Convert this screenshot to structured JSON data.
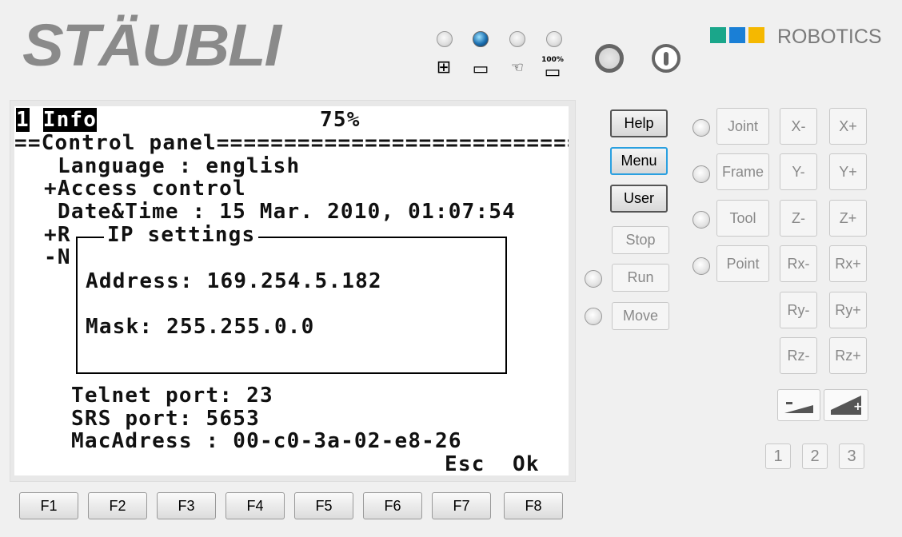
{
  "brand": {
    "logo": "STÄUBLI",
    "robotics": "ROBOTICS",
    "colors": [
      "#1aa68a",
      "#1a7fd6",
      "#f5b800"
    ]
  },
  "mode_indicators": [
    {
      "name": "remote-mode",
      "active": false,
      "glyph": "⊞"
    },
    {
      "name": "local-mode",
      "active": true,
      "glyph": "▭"
    },
    {
      "name": "manual-mode",
      "active": false,
      "glyph": "☜"
    },
    {
      "name": "speed-100",
      "active": false,
      "label": "100%",
      "glyph": "▭"
    }
  ],
  "screen": {
    "tab_number": "1",
    "tab_title": "Info",
    "speed": "75%",
    "section": "==Control panel===========================",
    "lines": {
      "language": "Language : english",
      "access": "+Access control",
      "datetime": "Date&Time : 15 Mar. 2010, 01:07:54",
      "r_prefix": "+R",
      "n_prefix": "-N"
    },
    "ip_dialog": {
      "title": "IP settings",
      "address": "Address: 169.254.5.182",
      "mask": "Mask: 255.255.0.0"
    },
    "lines2": {
      "telnet": "Telnet port: 23",
      "srs": "SRS port: 5653",
      "mac": "MacAdress : 00-c0-3a-02-e8-26"
    },
    "softkeys": {
      "esc": "Esc",
      "ok": "Ok"
    }
  },
  "buttons": {
    "help": "Help",
    "menu": "Menu",
    "user": "User",
    "stop": "Stop",
    "run": "Run",
    "move": "Move"
  },
  "jog_modes": [
    "Joint",
    "Frame",
    "Tool",
    "Point"
  ],
  "axes": [
    [
      "X-",
      "X+"
    ],
    [
      "Y-",
      "Y+"
    ],
    [
      "Z-",
      "Z+"
    ],
    [
      "Rx-",
      "Rx+"
    ],
    [
      "Ry-",
      "Ry+"
    ],
    [
      "Rz-",
      "Rz+"
    ]
  ],
  "speed_buttons": {
    "minus": "-",
    "plus": "+"
  },
  "numbers": [
    "1",
    "2",
    "3"
  ],
  "function_keys": [
    "F1",
    "F2",
    "F3",
    "F4",
    "F5",
    "F6",
    "F7",
    "F8"
  ]
}
